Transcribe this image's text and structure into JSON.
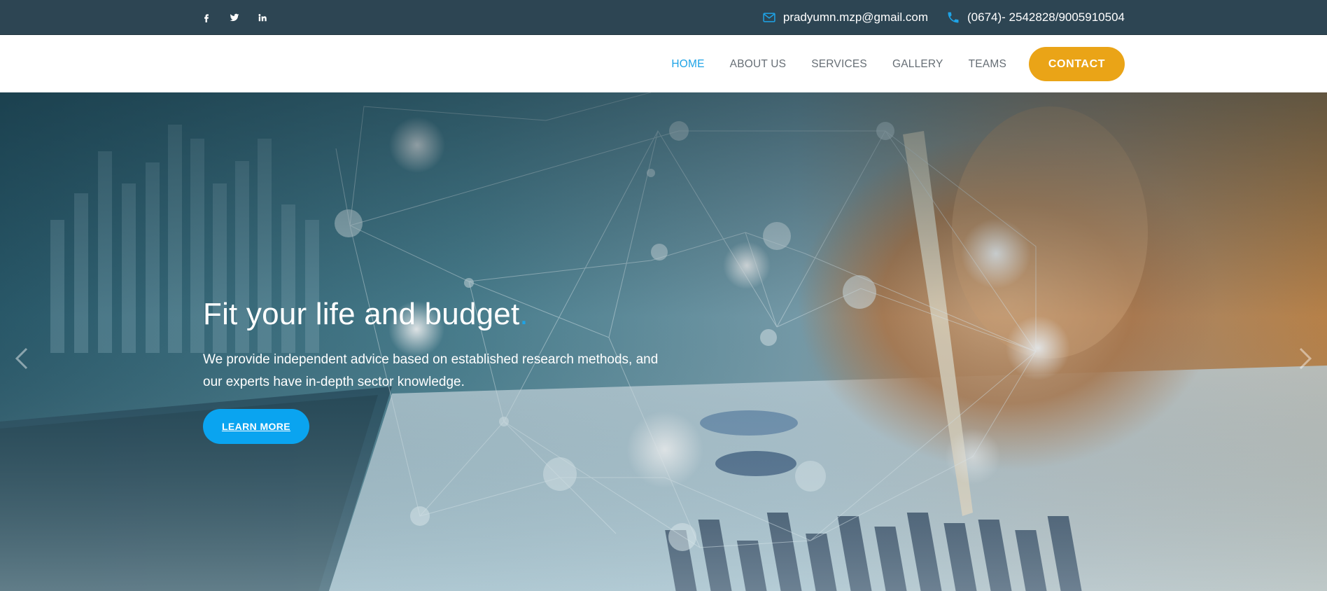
{
  "topbar": {
    "social": [
      {
        "name": "facebook-icon"
      },
      {
        "name": "twitter-icon"
      },
      {
        "name": "linkedin-icon"
      }
    ],
    "email": "pradyumn.mzp@gmail.com",
    "phone": "(0674)- 2542828/9005910504",
    "icons": {
      "email": "envelope-icon",
      "phone": "phone-icon"
    }
  },
  "nav": {
    "items": [
      "HOME",
      "ABOUT US",
      "SERVICES",
      "GALLERY",
      "TEAMS"
    ],
    "active": "HOME",
    "cta": "CONTACT"
  },
  "hero": {
    "title": "Fit your life and budget",
    "title_dot": ".",
    "description": "We provide independent advice based on established research methods, and our experts have in-depth sector knowledge.",
    "button": "LEARN MORE"
  },
  "colors": {
    "topbar": "#2d4553",
    "accent_blue": "#1ea3e6",
    "cta_orange": "#eaa417",
    "button_blue": "#0aa4f0"
  }
}
